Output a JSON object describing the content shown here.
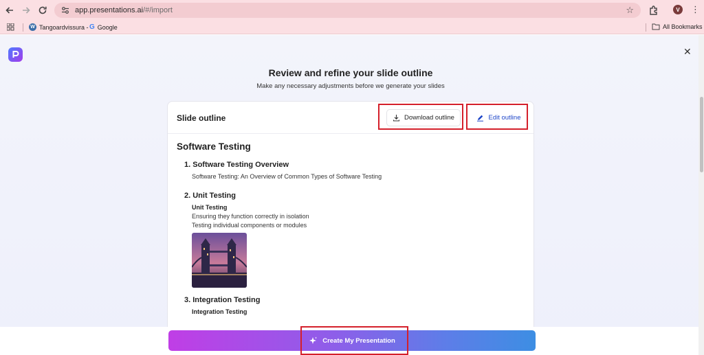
{
  "browser": {
    "url_main": "app.presentations.ai",
    "url_path": "/#/import",
    "bookmarks": [
      {
        "label": "Tangoardvissura -",
        "icon": "wordpress-icon"
      },
      {
        "label": "Google",
        "icon": "google-icon"
      }
    ],
    "all_bookmarks": "All Bookmarks",
    "profile_initial": "V"
  },
  "page": {
    "heading": "Review and refine your slide outline",
    "subheading": "Make any necessary adjustments before we generate your slides"
  },
  "card": {
    "title": "Slide outline",
    "download_label": "Download outline",
    "edit_label": "Edit outline"
  },
  "outline": {
    "title": "Software Testing",
    "sections": [
      {
        "title": "1. Software Testing Overview",
        "lines": [
          "Software Testing: An Overview of Common Types of Software Testing"
        ]
      },
      {
        "title": "2. Unit Testing",
        "subtitle": "Unit Testing",
        "lines": [
          "Ensuring they function correctly in isolation",
          "Testing individual components or modules"
        ],
        "image": "tower-bridge-thumbnail"
      },
      {
        "title": "3. Integration Testing",
        "subtitle": "Integration Testing"
      }
    ]
  },
  "footer": {
    "create_label": "Create My Presentation"
  },
  "colors": {
    "chrome": "#fbdfe3",
    "highlight": "#d41f2a",
    "edit_link": "#1f47c8"
  }
}
